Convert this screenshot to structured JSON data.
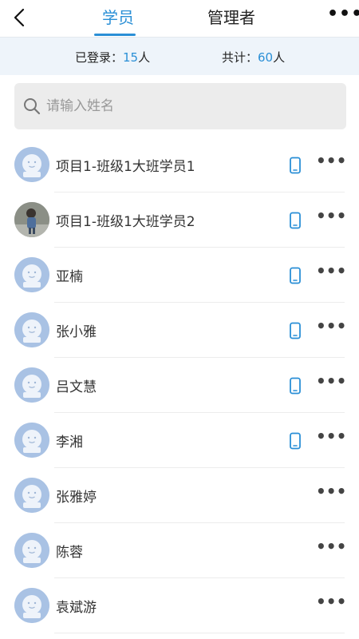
{
  "header": {
    "tabs": [
      {
        "label": "学员",
        "active": true
      },
      {
        "label": "管理者",
        "active": false
      }
    ],
    "more_label": "•••"
  },
  "stats": {
    "logged_label": "已登录：",
    "logged_value": "15",
    "logged_unit": "人",
    "total_label": "共计：",
    "total_value": "60",
    "total_unit": "人"
  },
  "search": {
    "placeholder": "请输入姓名"
  },
  "students": [
    {
      "name": "项目1-班级1大班学员1",
      "avatar": "default-avatar",
      "has_phone": true,
      "more": "•••"
    },
    {
      "name": "项目1-班级1大班学员2",
      "avatar": "photo-avatar",
      "has_phone": true,
      "more": "•••"
    },
    {
      "name": "亚楠",
      "avatar": "default-avatar",
      "has_phone": true,
      "more": "•••"
    },
    {
      "name": "张小雅",
      "avatar": "default-avatar",
      "has_phone": true,
      "more": "•••"
    },
    {
      "name": "吕文慧",
      "avatar": "default-avatar",
      "has_phone": true,
      "more": "•••"
    },
    {
      "name": "李湘",
      "avatar": "default-avatar",
      "has_phone": true,
      "more": "•••"
    },
    {
      "name": "张雅婷",
      "avatar": "default-avatar",
      "has_phone": false,
      "more": "•••"
    },
    {
      "name": "陈蓉",
      "avatar": "default-avatar",
      "has_phone": false,
      "more": "•••"
    },
    {
      "name": "袁斌游",
      "avatar": "default-avatar",
      "has_phone": false,
      "more": "•••"
    }
  ],
  "colors": {
    "accent": "#2a8fd6",
    "avatar_bg": "#a9c2e4",
    "stats_bg": "#eef4fa",
    "search_bg": "#ececec"
  }
}
